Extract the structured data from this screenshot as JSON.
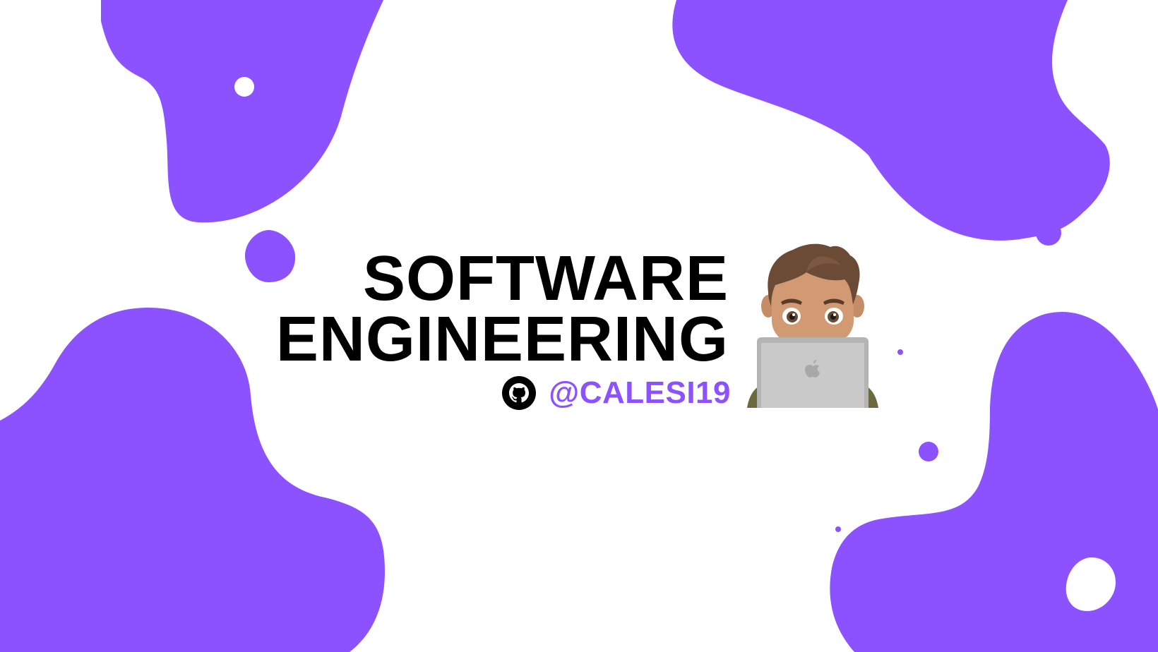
{
  "colors": {
    "background": "#ffffff",
    "accent": "#8c52ff",
    "title": "#000000"
  },
  "title": {
    "line1": "SOFTWARE",
    "line2": "ENGINEERING"
  },
  "social": {
    "icon": "github-icon",
    "handle": "@CALESI19"
  },
  "avatar": {
    "icon": "memoji-laptop-icon"
  }
}
